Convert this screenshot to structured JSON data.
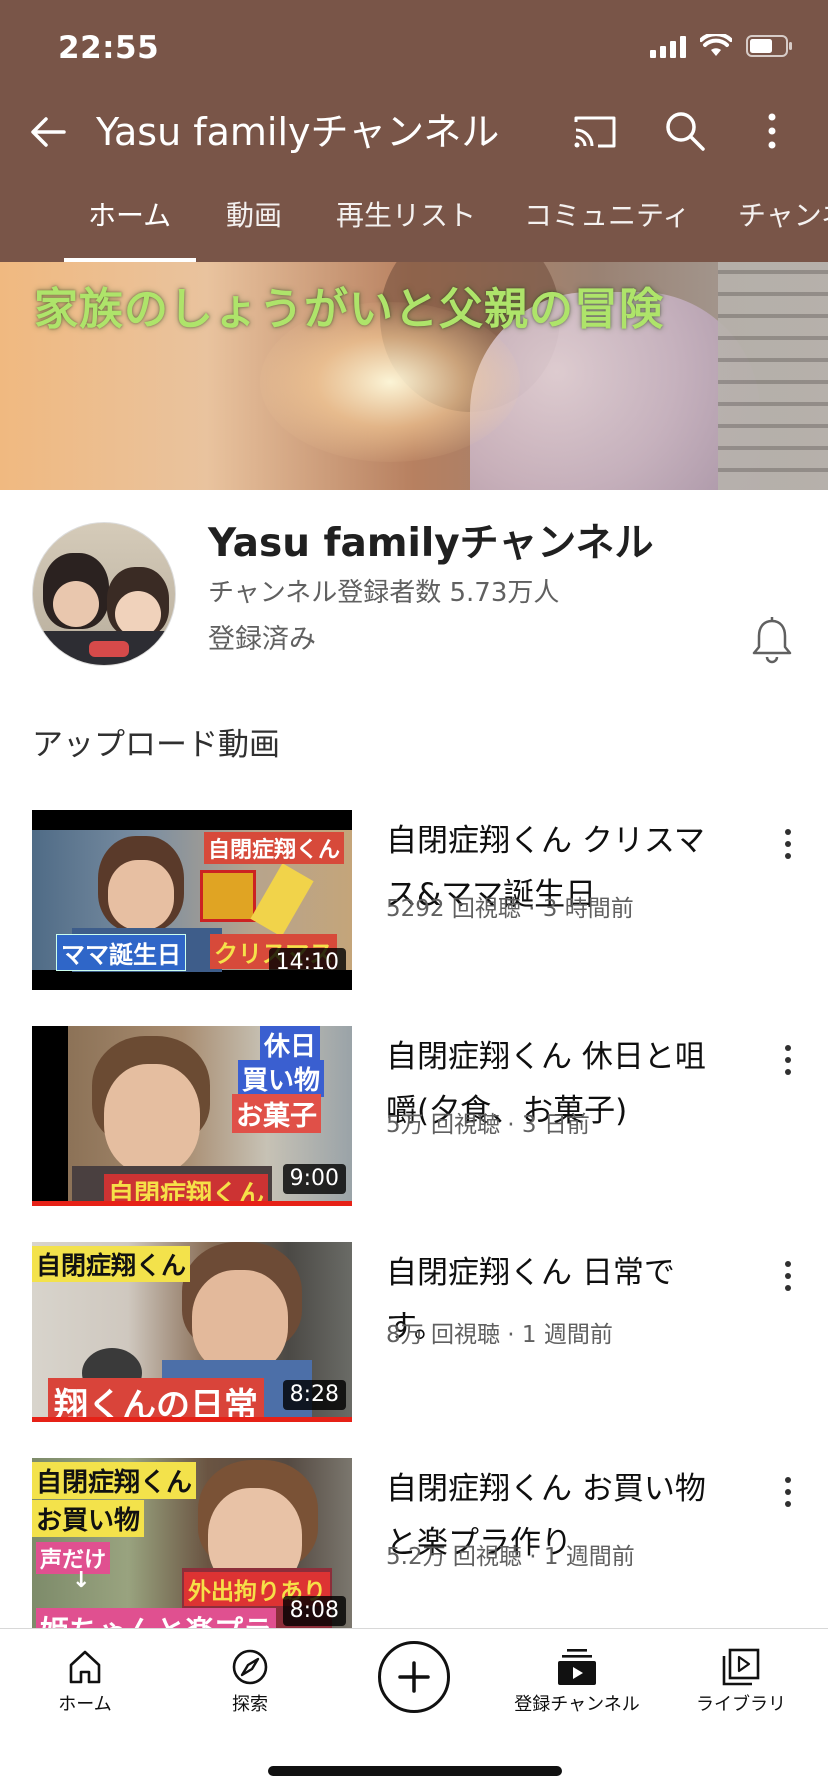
{
  "status_bar": {
    "time": "22:55"
  },
  "app_bar": {
    "title": "Yasu familyチャンネル",
    "icons": [
      "back-arrow-icon",
      "cast-icon",
      "search-icon",
      "more-vertical-icon"
    ]
  },
  "tabs": [
    {
      "label": "ホーム",
      "active": true
    },
    {
      "label": "動画",
      "active": false
    },
    {
      "label": "再生リスト",
      "active": false
    },
    {
      "label": "コミュニティ",
      "active": false
    },
    {
      "label": "チャンネル",
      "active": false
    }
  ],
  "banner": {
    "text": "家族のしょうがいと父親の冒険"
  },
  "channel": {
    "name": "Yasu familyチャンネル",
    "subscribers": "チャンネル登録者数 5.73万人",
    "subscribed_label": "登録済み"
  },
  "uploads": {
    "section_title": "アップロード動画",
    "videos": [
      {
        "title": "自閉症翔くん クリスマス&ママ誕生日",
        "meta": "5292 回視聴 · 3 時間前",
        "duration": "14:10",
        "overlay": [
          "自閉症翔くん",
          "ママ誕生日",
          "クリスマス"
        ]
      },
      {
        "title": "自閉症翔くん 休日と咀嚼(夕食、お菓子)",
        "meta": "5万 回視聴 · 3 日前",
        "duration": "9:00",
        "overlay": [
          "休日",
          "買い物",
          "お菓子",
          "自閉症翔くん"
        ],
        "watched_fraction": 1.0
      },
      {
        "title": "自閉症翔くん 日常です。",
        "meta": "8万 回視聴 · 1 週間前",
        "duration": "8:28",
        "overlay": [
          "自閉症翔くん",
          "翔くんの日常"
        ],
        "watched_fraction": 1.0
      },
      {
        "title": "自閉症翔くん お買い物と楽プラ作り",
        "meta": "5.2万 回視聴 · 1 週間前",
        "duration": "8:08",
        "overlay": [
          "自閉症翔くん",
          "お買い物",
          "声だけ",
          "↓",
          "外出拘りあり",
          "姫ちゃんと楽プラ"
        ]
      }
    ]
  },
  "bottom_nav": [
    {
      "label": "ホーム",
      "icon": "home-icon"
    },
    {
      "label": "探索",
      "icon": "compass-icon"
    },
    {
      "label": "",
      "icon": "create-plus-icon"
    },
    {
      "label": "登録チャンネル",
      "icon": "subscriptions-icon"
    },
    {
      "label": "ライブラリ",
      "icon": "library-icon"
    }
  ],
  "colors": {
    "header": "#795548",
    "progress": "#e62117",
    "banner_text": "#aee46a"
  }
}
